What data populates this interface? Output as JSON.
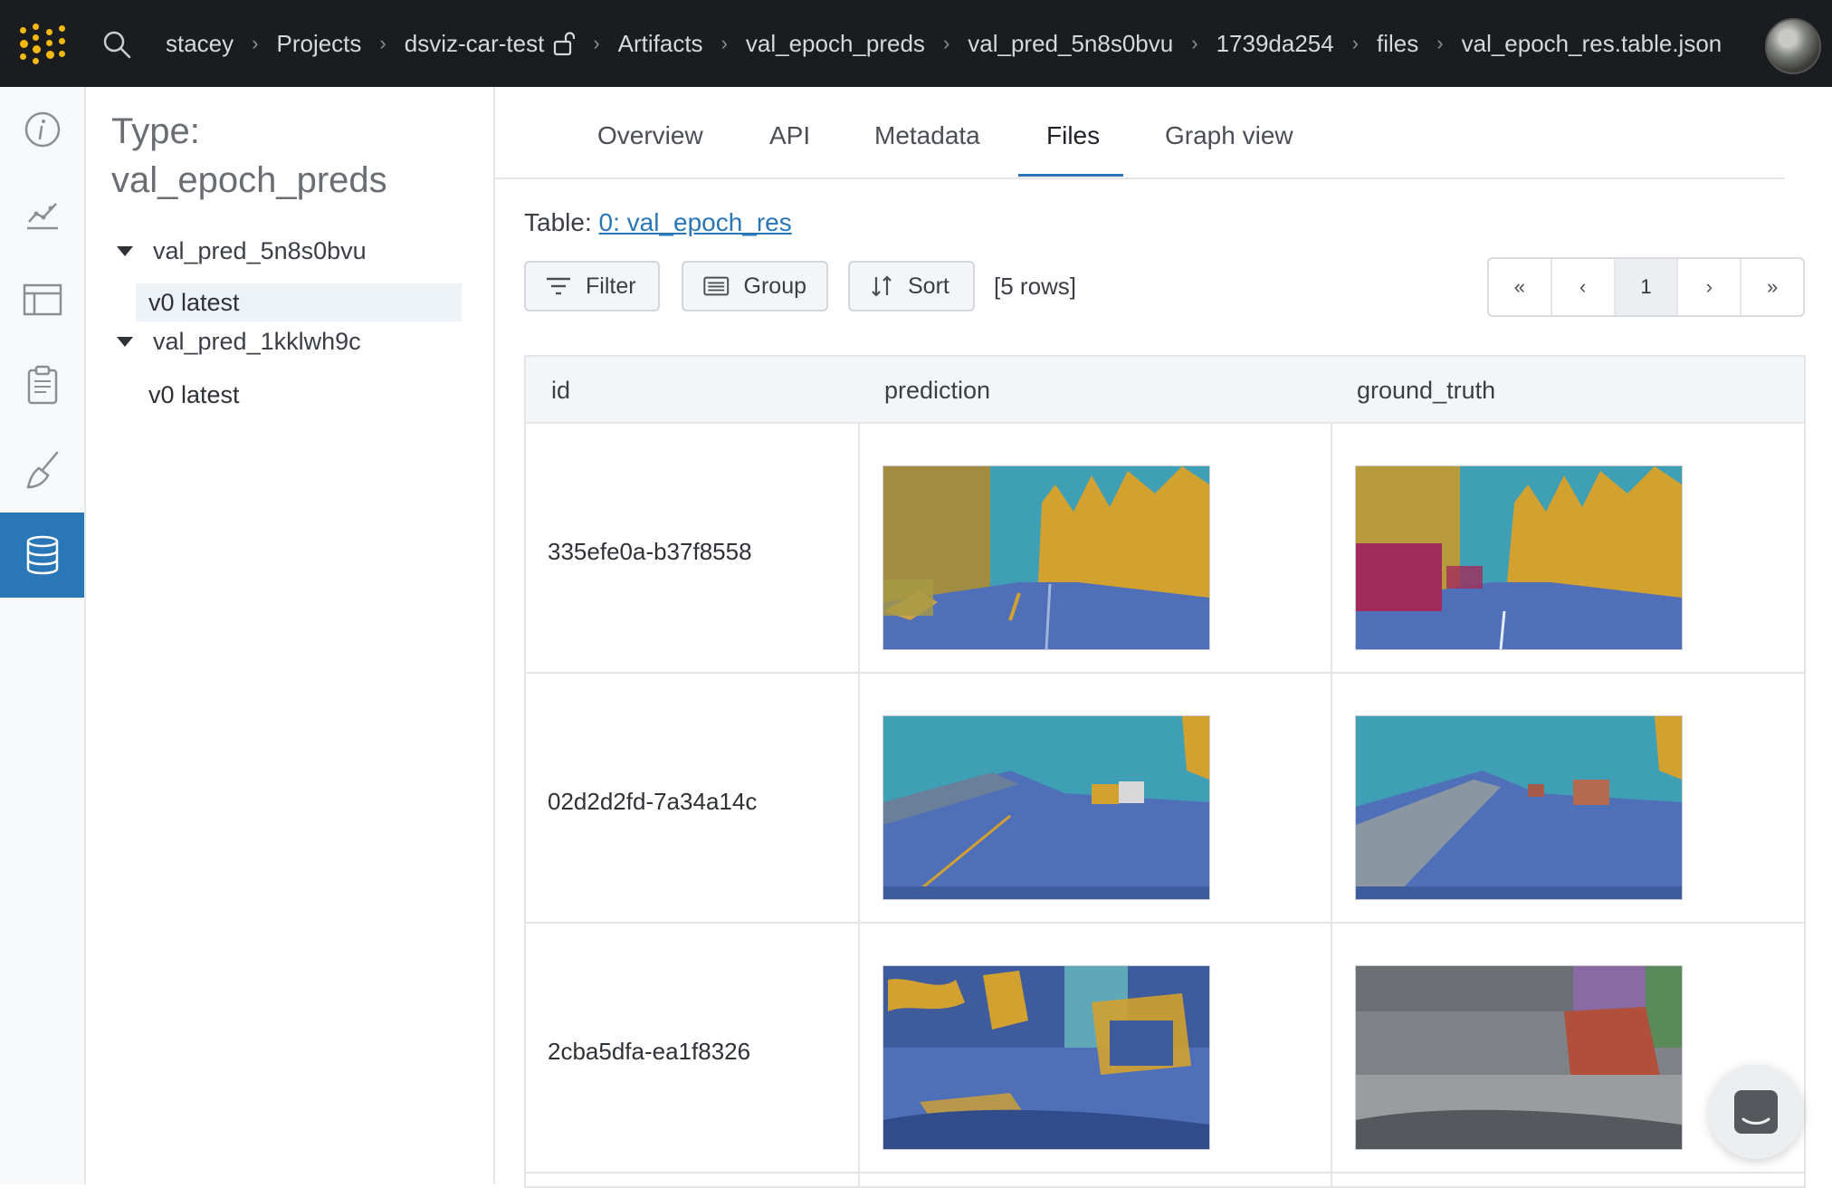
{
  "breadcrumbs": [
    "stacey",
    "Projects",
    "dsviz-car-test",
    "Artifacts",
    "val_epoch_preds",
    "val_pred_5n8s0bvu",
    "1739da254",
    "files",
    "val_epoch_res.table.json"
  ],
  "sidebar_panel": {
    "type_label": "Type:",
    "type_name": "val_epoch_preds",
    "artifacts": [
      {
        "name": "val_pred_5n8s0bvu",
        "versions": [
          "v0 latest"
        ]
      },
      {
        "name": "val_pred_1kklwh9c",
        "versions": [
          "v0 latest"
        ]
      }
    ]
  },
  "tabs": [
    "Overview",
    "API",
    "Metadata",
    "Files",
    "Graph view"
  ],
  "active_tab": "Files",
  "table": {
    "caption_prefix": "Table:",
    "caption_link": "0: val_epoch_res",
    "toolbar": {
      "filter": "Filter",
      "group": "Group",
      "sort": "Sort",
      "row_count": "[5 rows]"
    },
    "pager": {
      "first": "«",
      "prev": "‹",
      "current": "1",
      "next": "›",
      "last": "»"
    },
    "columns": [
      "id",
      "prediction",
      "ground_truth"
    ],
    "rows": [
      {
        "id": "335efe0a-b37f8558"
      },
      {
        "id": "02d2d2fd-7a34a14c"
      },
      {
        "id": "2cba5dfa-ea1f8326"
      }
    ]
  },
  "colors": {
    "topbar": "#1a1c1f",
    "accent": "#2a77b7",
    "logo": "#f4b90e",
    "seg_road": "#4f6fb8",
    "seg_sky": "#3f9fb4",
    "seg_veg": "#d3a12f",
    "seg_car": "#a12c5b"
  },
  "icons": [
    "app-logo-icon",
    "search-icon",
    "lock-open-icon",
    "info-icon",
    "chart-icon",
    "table-icon",
    "report-icon",
    "sweep-icon",
    "artifacts-icon",
    "filter-icon",
    "group-icon",
    "sort-icon",
    "chat-icon"
  ]
}
